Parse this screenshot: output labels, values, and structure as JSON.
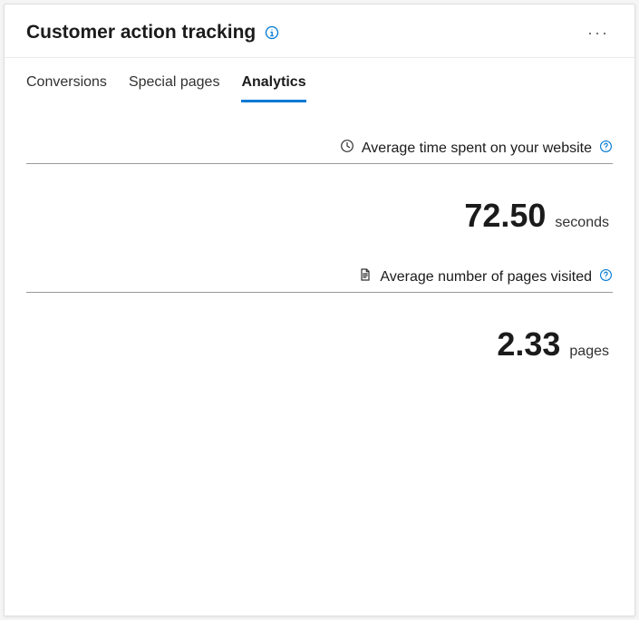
{
  "header": {
    "title": "Customer action tracking"
  },
  "tabs": [
    {
      "label": "Conversions",
      "active": false
    },
    {
      "label": "Special pages",
      "active": false
    },
    {
      "label": "Analytics",
      "active": true
    }
  ],
  "metrics": [
    {
      "icon": "clock-icon",
      "label": "Average time spent on your website",
      "value": "72.50",
      "unit": "seconds"
    },
    {
      "icon": "document-icon",
      "label": "Average number of pages visited",
      "value": "2.33",
      "unit": "pages"
    }
  ],
  "colors": {
    "accent": "#0078d4",
    "info": "#0078d4"
  }
}
